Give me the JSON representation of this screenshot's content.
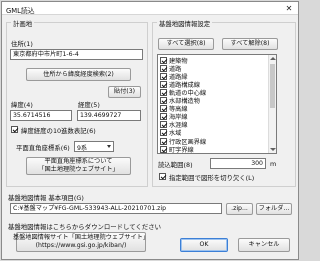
{
  "window": {
    "title": "GML読込",
    "close_symbol": "✕"
  },
  "keikaku": {
    "legend": "計画地",
    "address_label": "住所(1)",
    "address_value": "東京都府中市片町1-6-4",
    "geocode_button": "住所から緯度経度検索(2)",
    "paste_button": "貼付(3)",
    "lat_label": "緯度(4)",
    "lat_value": "35.6714516",
    "lon_label": "経度(5)",
    "lon_value": "139.4699727",
    "decimal_checkbox_label": "緯度経度の10進数表記(6)",
    "decimal_checked": true,
    "plane_label": "平面直角座標系(6)",
    "plane_value": "9系",
    "plane_button_line1": "平面直角座標系について",
    "plane_button_line2": "「国土地理院ウェブサイト」"
  },
  "layers": {
    "legend": "基盤地図情報設定",
    "select_all": "すべて選択(8)",
    "deselect_all": "すべて解除(8)",
    "items": [
      {
        "label": "建築物",
        "checked": true
      },
      {
        "label": "道路",
        "checked": true
      },
      {
        "label": "道路縁",
        "checked": true
      },
      {
        "label": "道路構成線",
        "checked": true
      },
      {
        "label": "軌道の中心線",
        "checked": true
      },
      {
        "label": "水部構造物",
        "checked": true
      },
      {
        "label": "等高線",
        "checked": true
      },
      {
        "label": "海岸線",
        "checked": true
      },
      {
        "label": "水涯線",
        "checked": true
      },
      {
        "label": "水域",
        "checked": true
      },
      {
        "label": "行政区画界線",
        "checked": true
      },
      {
        "label": "町字界線",
        "checked": true
      }
    ],
    "range_label": "読込範囲(8)",
    "range_value": "300",
    "range_unit": "m",
    "clip_checkbox_label": "指定範囲で図形を切り欠く(L)",
    "clip_checked": true
  },
  "file": {
    "label": "基盤地図情報 基本項目(G)",
    "path_value": "C:¥基盤マップ¥FG-GML-533943-ALL-20210701.zip",
    "zip_button": ".zip...",
    "folder_button": "フォルダ..."
  },
  "download": {
    "label": "基盤地図情報はこちらからダウンロードしてください",
    "site_button_line1": "基盤地図情報サイト「国土地理院ウェブサイト」",
    "site_button_line2": "(https://www.gsi.go.jp/kiban/)"
  },
  "footer": {
    "ok": "OK",
    "cancel": "キャンセル"
  }
}
